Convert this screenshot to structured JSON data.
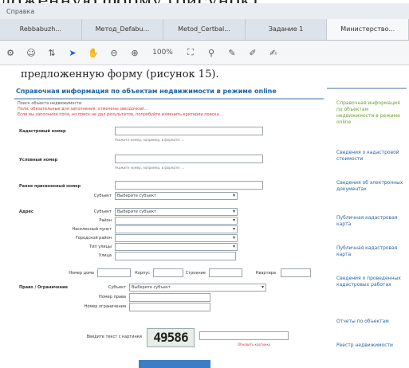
{
  "caption_top": "ложенную форму (рисунок).",
  "window": {
    "title": "Справка"
  },
  "tabs": [
    "Rebbabuzh...",
    "Метод_Defabu...",
    "Metod_Certbal...",
    "Задание 1",
    "Министерство..."
  ],
  "toolbar": {
    "zoom": "100%",
    "icons": [
      "settings-icon",
      "accessibility-icon",
      "cursor-icon",
      "hand-icon",
      "zoom-out-icon",
      "zoom-in-icon",
      "zoom-dropdown",
      "snapshot-icon",
      "pin-icon",
      "comment-icon",
      "pen-icon",
      "sign-icon"
    ]
  },
  "document": {
    "text": "предложенную форму (рисунок 15)."
  },
  "form": {
    "title": "Справочная информация по объектам недвижимости в режиме online",
    "notice_lines": [
      "Поиск объекта недвижимости",
      "Поля, обязательные для заполнения, отмечены звездочкой...",
      "Если вы заполнили поля, но поиск не дал результатов, попробуйте изменить критерии поиска..."
    ],
    "cadastral": {
      "label": "Кадастровый номер",
      "hint": "Укажите номер, например, в формате: ..."
    },
    "conditional": {
      "label": "Условный номер",
      "hint": "Укажите номер, например, в формате: ..."
    },
    "prev_cadastral": {
      "label": "Ранее присвоенный номер",
      "subject_label": "Субъект",
      "subject_value": "Выберите субъект"
    },
    "address": {
      "label": "Адрес",
      "rows": [
        {
          "label": "Субъект",
          "value": "Выберите субъект"
        },
        {
          "label": "Район",
          "value": ""
        },
        {
          "label": "Населенный пункт",
          "value": ""
        },
        {
          "label": "Городской район",
          "value": ""
        },
        {
          "label": "Тип улицы",
          "value": ""
        },
        {
          "label": "Улица",
          "value": ""
        }
      ],
      "bottom_labels": [
        "Номер дома",
        "Корпус",
        "Строение",
        "Квартира"
      ]
    },
    "rights": {
      "label": "Право / Ограничение",
      "rows": [
        {
          "label": "Субъект",
          "value": "Выберите субъект"
        },
        {
          "label": "Номер права",
          "value": ""
        },
        {
          "label": "Номер ограничения",
          "value": ""
        }
      ]
    },
    "captcha": {
      "label": "Введите текст с картинки",
      "code": "49586",
      "refresh": "Обновить картинку"
    },
    "submit_label": ""
  },
  "sidebar": {
    "items": [
      "Справочная информация по объектам недвижимости в режиме online",
      "Сведения о кадастровой стоимости",
      "Сведения об электронных документах",
      "Публичная кадастровая карта",
      "Публичная кадастровая карта",
      "Сведения о проведенных кадастровых работах",
      "Отчеты по объектам",
      "Реестр недвижимости"
    ]
  }
}
